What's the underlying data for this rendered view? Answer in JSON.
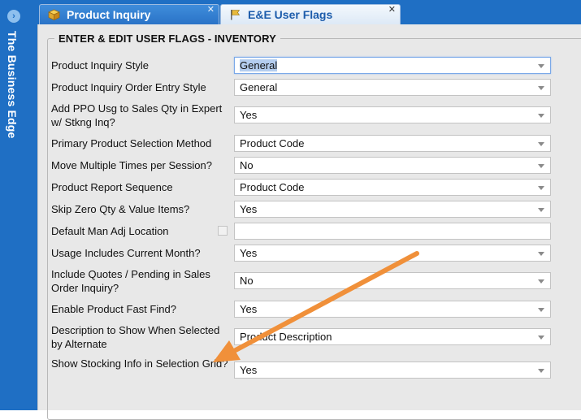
{
  "sidebar": {
    "brand": "The Business Edge",
    "expand_icon": "chevron-right-icon"
  },
  "tabs": [
    {
      "label": "Product Inquiry",
      "icon": "cube-icon",
      "close": "✕"
    },
    {
      "label": "E&E User Flags",
      "icon": "flag-icon",
      "close": "✕"
    }
  ],
  "section_title": "ENTER & EDIT USER FLAGS - INVENTORY",
  "fields": [
    {
      "label": "Product Inquiry Style",
      "value": "General",
      "type": "select"
    },
    {
      "label": "Product Inquiry Order Entry Style",
      "value": "General",
      "type": "select"
    },
    {
      "label": "Add PPO Usg to Sales Qty in Expert w/ Stkng Inq?",
      "value": "Yes",
      "type": "select"
    },
    {
      "label": "Primary Product Selection Method",
      "value": "Product Code",
      "type": "select"
    },
    {
      "label": "Move Multiple Times per Session?",
      "value": "No",
      "type": "select"
    },
    {
      "label": "Product Report Sequence",
      "value": "Product Code",
      "type": "select"
    },
    {
      "label": "Skip Zero Qty & Value Items?",
      "value": "Yes",
      "type": "select"
    },
    {
      "label": "Default Man Adj Location",
      "value": "",
      "type": "text"
    },
    {
      "label": "Usage Includes Current Month?",
      "value": "Yes",
      "type": "select"
    },
    {
      "label": "Include Quotes / Pending in Sales Order Inquiry?",
      "value": "No",
      "type": "select"
    },
    {
      "label": "Enable Product Fast Find?",
      "value": "Yes",
      "type": "select"
    },
    {
      "label": "Description to Show When Selected by Alternate",
      "value": "Product Description",
      "type": "select"
    },
    {
      "label": "Show Stocking Info in Selection Grid?",
      "value": "Yes",
      "type": "select"
    }
  ],
  "colors": {
    "brand_blue": "#1f6fc4",
    "panel_bg": "#e8e8e8",
    "annotation_arrow": "#f0903a"
  }
}
